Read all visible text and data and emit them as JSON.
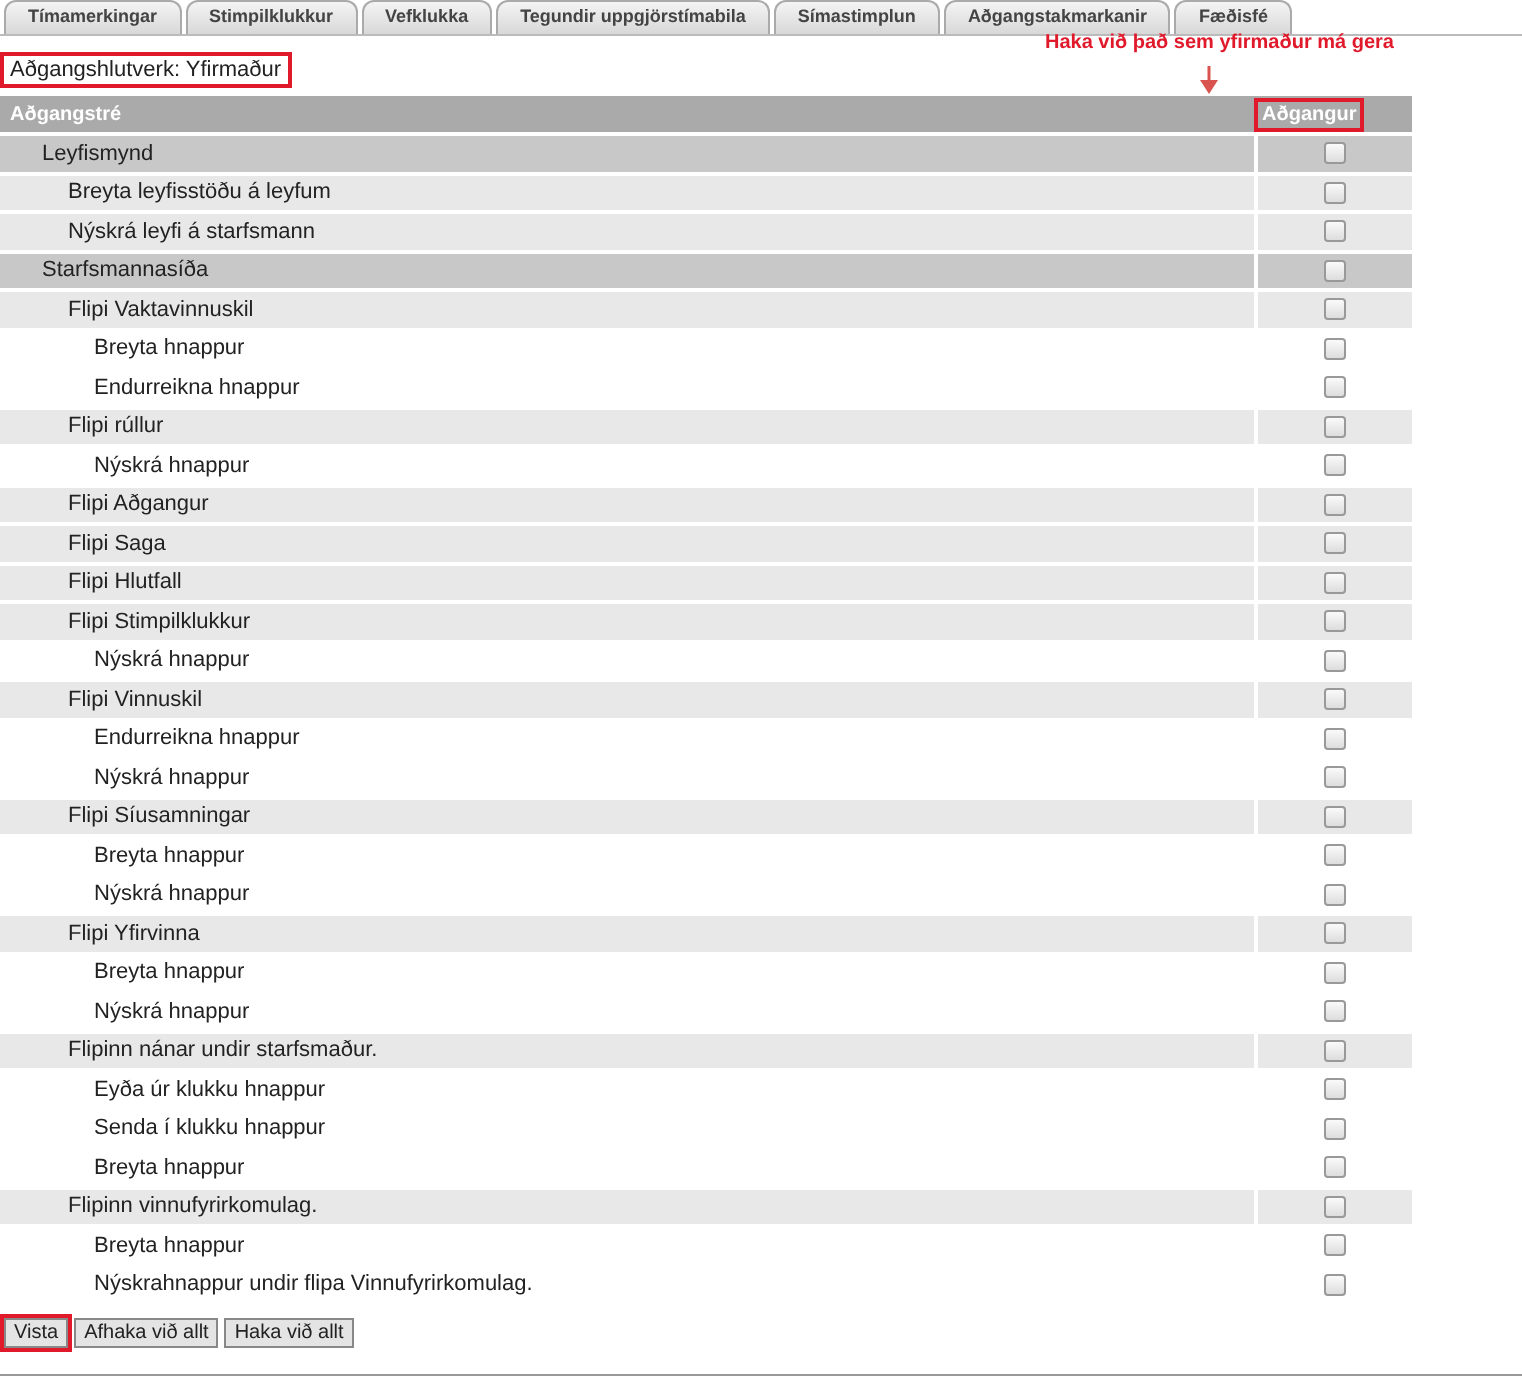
{
  "tabs": [
    {
      "label": "Tímamerkingar",
      "selected": false
    },
    {
      "label": "Stimpilklukkur",
      "selected": false
    },
    {
      "label": "Vefklukka",
      "selected": false
    },
    {
      "label": "Tegundir uppgjörstímabila",
      "selected": false
    },
    {
      "label": "Símastimplun",
      "selected": false
    },
    {
      "label": "Aðgangstakmarkanir",
      "selected": false
    },
    {
      "label": "Fæðisfé",
      "selected": false
    }
  ],
  "role": {
    "text": "Aðgangshlutverk: Yfirmaður",
    "annotated": true
  },
  "annotation": {
    "text": "Haka við það sem yfirmaður má gera"
  },
  "table": {
    "columns": [
      {
        "label": "Aðgangstré",
        "annotated": false
      },
      {
        "label": "Aðgangur",
        "annotated": true
      }
    ],
    "rows": [
      {
        "label": "Leyfismynd",
        "checked": false,
        "children": [
          {
            "label": "Breyta leyfisstöðu á leyfum",
            "checked": false
          },
          {
            "label": "Nýskrá leyfi á starfsmann",
            "checked": false
          }
        ]
      },
      {
        "label": "Starfsmannasíða",
        "checked": false,
        "children": [
          {
            "label": "Flipi Vaktavinnuskil",
            "checked": false,
            "children": [
              {
                "label": "Breyta hnappur",
                "checked": false
              },
              {
                "label": "Endurreikna hnappur",
                "checked": false
              }
            ]
          },
          {
            "label": "Flipi rúllur",
            "checked": false,
            "children": [
              {
                "label": "Nýskrá hnappur",
                "checked": false
              }
            ]
          },
          {
            "label": "Flipi Aðgangur",
            "checked": false
          },
          {
            "label": "Flipi Saga",
            "checked": false
          },
          {
            "label": "Flipi Hlutfall",
            "checked": false
          },
          {
            "label": "Flipi Stimpilklukkur",
            "checked": false,
            "children": [
              {
                "label": "Nýskrá hnappur",
                "checked": false
              }
            ]
          },
          {
            "label": "Flipi Vinnuskil",
            "checked": false,
            "children": [
              {
                "label": "Endurreikna hnappur",
                "checked": false
              },
              {
                "label": "Nýskrá hnappur",
                "checked": false
              }
            ]
          },
          {
            "label": "Flipi Síusamningar",
            "checked": false,
            "children": [
              {
                "label": "Breyta hnappur",
                "checked": false
              },
              {
                "label": "Nýskrá hnappur",
                "checked": false
              }
            ]
          },
          {
            "label": "Flipi Yfirvinna",
            "checked": false,
            "children": [
              {
                "label": "Breyta hnappur",
                "checked": false
              },
              {
                "label": "Nýskrá hnappur",
                "checked": false
              }
            ]
          },
          {
            "label": "Flipinn nánar undir starfsmaður.",
            "checked": false,
            "children": [
              {
                "label": "Eyða úr klukku hnappur",
                "checked": false
              },
              {
                "label": "Senda í klukku hnappur",
                "checked": false
              },
              {
                "label": "Breyta hnappur",
                "checked": false
              }
            ]
          },
          {
            "label": "Flipinn vinnufyrirkomulag.",
            "checked": false,
            "children": [
              {
                "label": "Breyta hnappur",
                "checked": false
              },
              {
                "label": "Nýskrahnappur undir flipa Vinnufyrirkomulag.",
                "checked": false
              }
            ]
          }
        ]
      }
    ]
  },
  "buttons": [
    {
      "label": "Vista",
      "annotated": true
    },
    {
      "label": "Afhaka við allt",
      "annotated": false
    },
    {
      "label": "Haka við allt",
      "annotated": false
    }
  ]
}
